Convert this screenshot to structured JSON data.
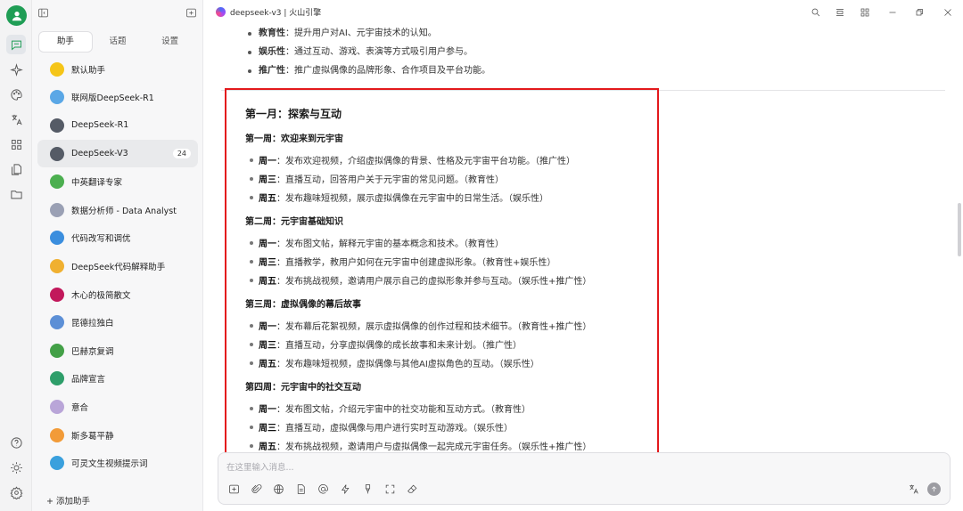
{
  "window": {
    "title": "deepseek-v3 | 火山引擎"
  },
  "sidebar": {
    "tabs": [
      {
        "label": "助手",
        "active": true
      },
      {
        "label": "话题",
        "active": false
      },
      {
        "label": "设置",
        "active": false
      }
    ],
    "assistants": [
      {
        "label": "默认助手",
        "icon": "star-icon",
        "color": "#f5c518"
      },
      {
        "label": "联网版DeepSeek-R1",
        "icon": "globe-icon",
        "color": "#5aa7e6"
      },
      {
        "label": "DeepSeek-R1",
        "icon": "robot-icon",
        "color": "#555b66"
      },
      {
        "label": "DeepSeek-V3",
        "icon": "robot-icon",
        "color": "#555b66",
        "badge": "24",
        "active": true
      },
      {
        "label": "中英翻译专家",
        "icon": "books-icon",
        "color": "#4caf50"
      },
      {
        "label": "数据分析师 - Data Analyst",
        "icon": "chart-icon",
        "color": "#9aa0b4"
      },
      {
        "label": "代码改写和调优",
        "icon": "monitor-icon",
        "color": "#3b8ede"
      },
      {
        "label": "DeepSeek代码解释助手",
        "icon": "face-icon",
        "color": "#f0b030"
      },
      {
        "label": "木心的极简散文",
        "icon": "book-icon",
        "color": "#c2185b"
      },
      {
        "label": "昆德拉独白",
        "icon": "open-book-icon",
        "color": "#5c8fd6"
      },
      {
        "label": "巴赫京复调",
        "icon": "notebook-icon",
        "color": "#43a047"
      },
      {
        "label": "品牌宣言",
        "icon": "image-icon",
        "color": "#2e9e6a"
      },
      {
        "label": "意合",
        "icon": "chat-icon",
        "color": "#b9a5d8"
      },
      {
        "label": "斯多葛平静",
        "icon": "person-icon",
        "color": "#f29b38"
      },
      {
        "label": "可灵文生视频提示词",
        "icon": "screen-icon",
        "color": "#3aa0dd"
      }
    ],
    "add_label": "+ 添加助手"
  },
  "content": {
    "upper_bullets": [
      {
        "term": "教育性",
        "text": "：提升用户对AI、元宇宙技术的认知。"
      },
      {
        "term": "娱乐性",
        "text": "：通过互动、游戏、表演等方式吸引用户参与。"
      },
      {
        "term": "推广性",
        "text": "：推广虚拟偶像的品牌形象、合作项目及平台功能。"
      }
    ],
    "month_title": "第一月：探索与互动",
    "weeks": [
      {
        "title": "第一周：欢迎来到元宇宙",
        "items": [
          {
            "day": "周一",
            "text": "：发布欢迎视频，介绍虚拟偶像的背景、性格及元宇宙平台功能。（推广性）"
          },
          {
            "day": "周三",
            "text": "：直播互动，回答用户关于元宇宙的常见问题。（教育性）"
          },
          {
            "day": "周五",
            "text": "：发布趣味短视频，展示虚拟偶像在元宇宙中的日常生活。（娱乐性）"
          }
        ]
      },
      {
        "title": "第二周：元宇宙基础知识",
        "items": [
          {
            "day": "周一",
            "text": "：发布图文帖，解释元宇宙的基本概念和技术。（教育性）"
          },
          {
            "day": "周三",
            "text": "：直播教学，教用户如何在元宇宙中创建虚拟形象。（教育性+娱乐性）"
          },
          {
            "day": "周五",
            "text": "：发布挑战视频，邀请用户展示自己的虚拟形象并参与互动。（娱乐性+推广性）"
          }
        ]
      },
      {
        "title": "第三周：虚拟偶像的幕后故事",
        "items": [
          {
            "day": "周一",
            "text": "：发布幕后花絮视频，展示虚拟偶像的创作过程和技术细节。（教育性+推广性）"
          },
          {
            "day": "周三",
            "text": "：直播互动，分享虚拟偶像的成长故事和未来计划。（推广性）"
          },
          {
            "day": "周五",
            "text": "：发布趣味短视频，虚拟偶像与其他AI虚拟角色的互动。（娱乐性）"
          }
        ]
      },
      {
        "title": "第四周：元宇宙中的社交互动",
        "items": [
          {
            "day": "周一",
            "text": "：发布图文帖，介绍元宇宙中的社交功能和互动方式。（教育性）"
          },
          {
            "day": "周三",
            "text": "：直播互动，虚拟偶像与用户进行实时互动游戏。（娱乐性）"
          },
          {
            "day": "周五",
            "text": "：发布挑战视频，邀请用户与虚拟偶像一起完成元宇宙任务。（娱乐性+推广性）"
          }
        ]
      }
    ]
  },
  "input": {
    "placeholder": "在这里输入消息..."
  },
  "colors": {
    "accent": "#1f9d55",
    "highlight_border": "#e3191c"
  }
}
